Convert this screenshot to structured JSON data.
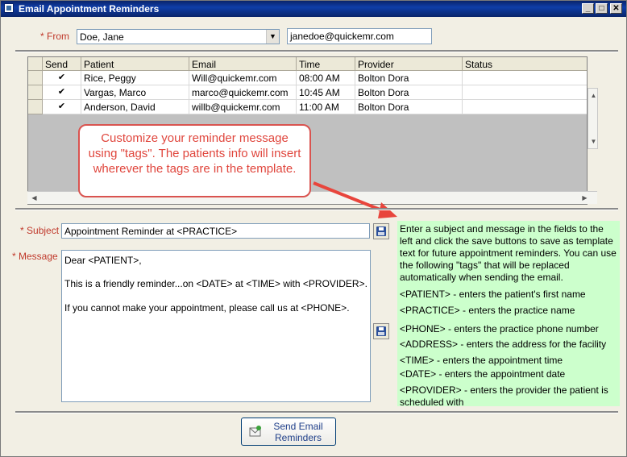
{
  "window": {
    "title": "Email Appointment Reminders"
  },
  "from": {
    "label": "From",
    "required_mark": "*",
    "selected": "Doe, Jane",
    "email": "janedoe@quickemr.com"
  },
  "grid": {
    "columns": [
      "Send",
      "Patient",
      "Email",
      "Time",
      "Provider",
      "Status"
    ],
    "rows": [
      {
        "send": true,
        "patient": "Rice, Peggy",
        "email": "Will@quickemr.com",
        "time": "08:00 AM",
        "provider": "Bolton Dora",
        "status": ""
      },
      {
        "send": true,
        "patient": "Vargas, Marco",
        "email": "marco@quickemr.com",
        "time": "10:45 AM",
        "provider": "Bolton Dora",
        "status": ""
      },
      {
        "send": true,
        "patient": "Anderson, David",
        "email": "willb@quickemr.com",
        "time": "11:00 AM",
        "provider": "Bolton Dora",
        "status": ""
      }
    ]
  },
  "callout": {
    "text": "Customize your reminder message using \"tags\". The patients info will insert wherever the tags are in the template."
  },
  "subject": {
    "label": "Subject",
    "required_mark": "*",
    "value": "Appointment Reminder at <PRACTICE>"
  },
  "message": {
    "label": "Message",
    "required_mark": "*",
    "lines": [
      "Dear <PATIENT>,",
      "This is a friendly reminder...on <DATE> at <TIME> with <PROVIDER>.",
      "If you cannot make your appointment, please call us at <PHONE>."
    ]
  },
  "help": {
    "intro": "Enter a subject and message in the fields to the left and click the save buttons to save as template text for future appointment reminders. You can use the following \"tags\" that will be replaced automatically when sending the email.",
    "tags": [
      "<PATIENT> - enters the patient's first name",
      "<PRACTICE> - enters the practice name",
      "<PHONE> - enters the practice phone number",
      "<ADDRESS> - enters the address for the facility",
      "<TIME> - enters the appointment time",
      "<DATE> - enters the appointment date",
      "<PROVIDER> - enters the provider the patient is scheduled with"
    ]
  },
  "send_button": {
    "label": "Send Email Reminders"
  },
  "colors": {
    "help_bg": "#ccffcc",
    "callout": "#e0463d",
    "required": "#c0392b",
    "arrow": "#e8453c"
  },
  "icons": [
    "app-icon",
    "minimize-icon",
    "maximize-icon",
    "close-icon",
    "dropdown-arrow-icon",
    "checkbox-checked-icon",
    "save-disk-icon",
    "email-send-icon",
    "red-arrow-icon"
  ]
}
